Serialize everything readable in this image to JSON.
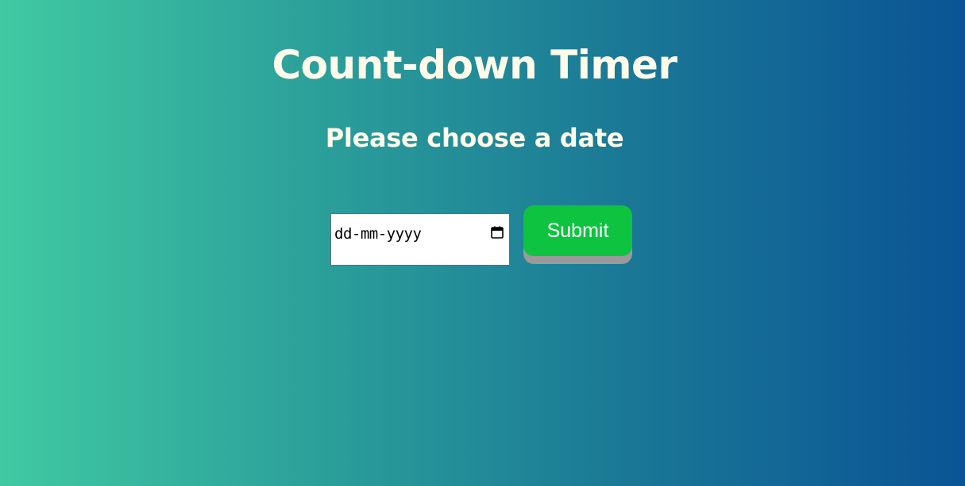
{
  "header": {
    "title": "Count-down Timer",
    "subtitle": "Please choose a date"
  },
  "form": {
    "date_placeholder": "dd-mm-yyyy",
    "date_value": "",
    "submit_label": "Submit"
  },
  "icons": {
    "date_picker": "calendar-icon"
  },
  "colors": {
    "gradient_start": "#40c9a2",
    "gradient_end": "#0a5495",
    "heading_text": "#fffbe9",
    "submit_bg": "#0ec33f",
    "submit_shadow": "#9a9a9a"
  }
}
